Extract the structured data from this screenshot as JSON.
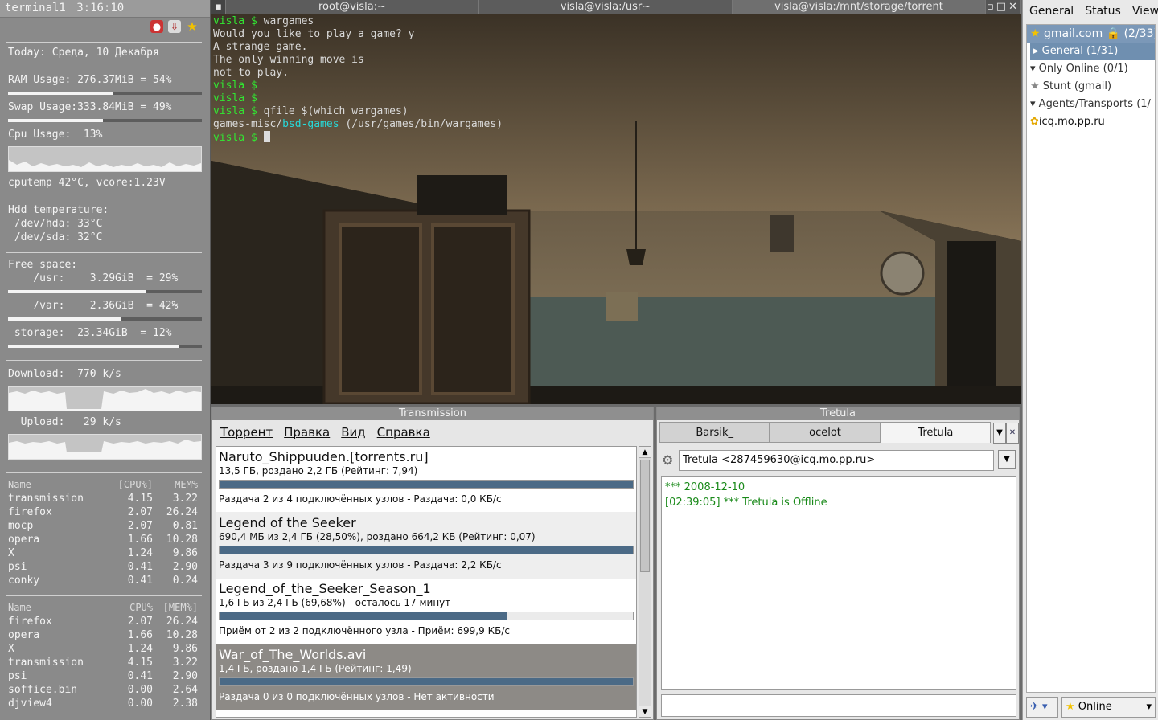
{
  "conky": {
    "title": "terminal1",
    "time": "3:16:10",
    "today": "Today: Среда, 10 Декабря",
    "ram": "RAM Usage: 276.37MiB = 54%",
    "ram_fraction": 0.54,
    "swap": "Swap Usage:333.84MiB = 49%",
    "swap_fraction": 0.49,
    "cpu": "Cpu Usage:  13%",
    "cputemp": "cputemp 42°C, vcore:1.23V",
    "hdd_title": "Hdd temperature:",
    "hda": " /dev/hda: 33°C",
    "sda": " /dev/sda: 32°C",
    "free_title": "Free space:",
    "usr": "    /usr:    3.29GiB  = 29%",
    "usr_fraction": 0.71,
    "var": "    /var:    2.36GiB  = 42%",
    "var_fraction": 0.58,
    "storage": " storage:  23.34GiB  = 12%",
    "storage_fraction": 0.88,
    "download": "Download:  770 k/s",
    "upload": "  Upload:   29 k/s",
    "cpu_table": {
      "h_name": "Name",
      "h_cpu": "[CPU%]",
      "h_mem": "MEM%",
      "rows": [
        {
          "name": "transmission",
          "cpu": "4.15",
          "mem": "3.22"
        },
        {
          "name": "firefox",
          "cpu": "2.07",
          "mem": "26.24"
        },
        {
          "name": "mocp",
          "cpu": "2.07",
          "mem": "0.81"
        },
        {
          "name": "opera",
          "cpu": "1.66",
          "mem": "10.28"
        },
        {
          "name": "X",
          "cpu": "1.24",
          "mem": "9.86"
        },
        {
          "name": "psi",
          "cpu": "0.41",
          "mem": "2.90"
        },
        {
          "name": "conky",
          "cpu": "0.41",
          "mem": "0.24"
        }
      ]
    },
    "mem_table": {
      "h_name": "Name",
      "h_cpu": "CPU%",
      "h_mem": "[MEM%]",
      "rows": [
        {
          "name": "firefox",
          "cpu": "2.07",
          "mem": "26.24"
        },
        {
          "name": "opera",
          "cpu": "1.66",
          "mem": "10.28"
        },
        {
          "name": "X",
          "cpu": "1.24",
          "mem": "9.86"
        },
        {
          "name": "transmission",
          "cpu": "4.15",
          "mem": "3.22"
        },
        {
          "name": "psi",
          "cpu": "0.41",
          "mem": "2.90"
        },
        {
          "name": "soffice.bin",
          "cpu": "0.00",
          "mem": "2.64"
        },
        {
          "name": "djview4",
          "cpu": "0.00",
          "mem": "2.38"
        }
      ]
    }
  },
  "terminal": {
    "tabs": [
      "root@visla:~",
      "visla@visla:/usr~",
      "visla@visla:/mnt/storage/torrent"
    ],
    "lines": {
      "l1p": "visla $",
      "l1c": " wargames",
      "l2": "Would you like to play a game? y",
      "l3": "A strange game.",
      "l4": "The only winning move is",
      "l5": "not to play.",
      "l6p": "visla $",
      "l7p": "visla $",
      "l8p": "visla $",
      "l8c": " qfile $(which wargames)",
      "l9a": "games-misc/",
      "l9b": "bsd-games",
      "l9c": " (/usr/games/bin/wargames)",
      "l10p": "visla $"
    }
  },
  "transmission": {
    "title": "Transmission",
    "menu": [
      "Торрент",
      "Правка",
      "Вид",
      "Справка"
    ],
    "torrents": [
      {
        "name": "Naruto_Shippuuden.[torrents.ru]",
        "info": "13,5 ГБ, роздано 2,2 ГБ (Рейтинг: 7,94)",
        "progress": 1.0,
        "status": "Раздача 2 из 4 подключённых узлов - Раздача: 0,0 КБ/с"
      },
      {
        "name": "Legend of the Seeker",
        "info": "690,4 МБ из 2,4 ГБ (28,50%), роздано 664,2 КБ (Рейтинг: 0,07)",
        "progress": 1.0,
        "status": "Раздача 3 из 9 подключённых узлов - Раздача: 2,2 КБ/с"
      },
      {
        "name": "Legend_of_the_Seeker_Season_1",
        "info": "1,6 ГБ из 2,4 ГБ (69,68%) - осталось 17 минут",
        "progress": 0.6968,
        "status": "Приём от 2 из 2 подключённого узла - Приём: 699,9 КБ/с"
      },
      {
        "name": "War_of_The_Worlds.avi",
        "info": "1,4 ГБ, роздано 1,4 ГБ (Рейтинг: 1,49)",
        "progress": 1.0,
        "status": "Раздача 0 из 0 подключённых узлов - Нет активности"
      }
    ]
  },
  "tretula": {
    "title": "Tretula",
    "tabs": [
      "Barsik_",
      "ocelot",
      "Tretula"
    ],
    "contact": "Tretula <287459630@icq.mo.pp.ru>",
    "log": [
      "*** 2008-12-10",
      "[02:39:05] *** Tretula is Offline"
    ]
  },
  "psi": {
    "menu": [
      "General",
      "Status",
      "View"
    ],
    "items": [
      {
        "label": "gmail.com",
        "extra": "(2/33)"
      },
      {
        "label": "General (1/31)"
      },
      {
        "label": "Only Online (0/1)"
      },
      {
        "label": "Stunt (gmail)"
      },
      {
        "label": "Agents/Transports (1/"
      },
      {
        "label": "icq.mo.pp.ru"
      }
    ],
    "status": "Online"
  }
}
